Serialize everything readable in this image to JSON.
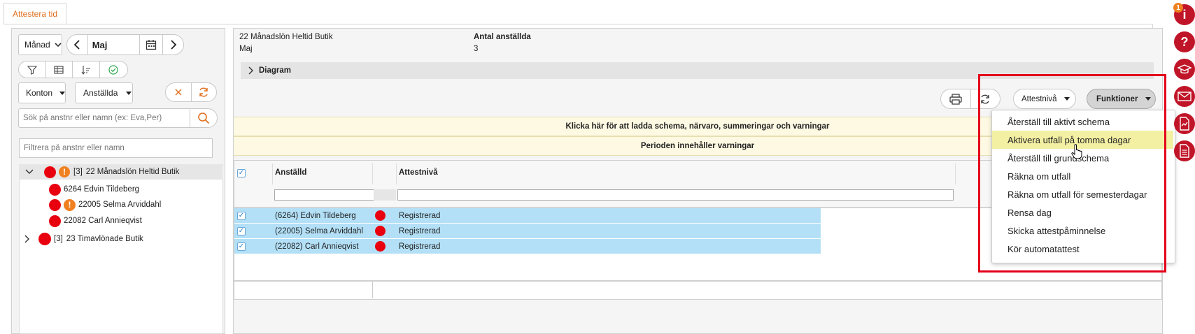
{
  "tab": {
    "label": "Attestera tid"
  },
  "toolbar": {
    "period_select": "Månad",
    "period_value": "Maj",
    "konton_select": "Konton",
    "anstallda_select": "Anställda",
    "search_placeholder": "Sök på anstnr eller namn (ex: Eva,Per)",
    "filter_placeholder": "Filtrera på anstnr eller namn"
  },
  "tree": {
    "group1": {
      "count": "[3]",
      "name": "22 Månadslön Heltid Butik"
    },
    "employees": [
      {
        "label": "6264 Edvin Tildeberg"
      },
      {
        "label": "22005 Selma Arviddahl"
      },
      {
        "label": "22082 Carl Annieqvist"
      }
    ],
    "group2": {
      "count": "[3]",
      "name": "23 Timavlönade Butik"
    }
  },
  "header": {
    "group_name": "22 Månadslön Heltid Butik",
    "period": "Maj",
    "count_label": "Antal anställda",
    "count_value": "3",
    "diagram_label": "Diagram"
  },
  "actions": {
    "attestniva_label": "Attestnivå",
    "funktioner_label": "Funktioner"
  },
  "banners": {
    "load_text": "Klicka här för att ladda schema, närvaro, summeringar och varningar",
    "warning_text": "Perioden innehåller varningar"
  },
  "grid": {
    "col_employee": "Anställd",
    "col_level": "Attestnivå",
    "rows": [
      {
        "employee": "(6264) Edvin Tildeberg",
        "level": "Registrerad"
      },
      {
        "employee": "(22005) Selma Arviddahl",
        "level": "Registrerad"
      },
      {
        "employee": "(22082) Carl Annieqvist",
        "level": "Registrerad"
      }
    ]
  },
  "menu": {
    "items": [
      {
        "label": "Återställ till aktivt schema"
      },
      {
        "label": "Aktivera utfall på tomma dagar"
      },
      {
        "label": "Återställ till grundschema"
      },
      {
        "label": "Räkna om utfall"
      },
      {
        "label": "Räkna om utfall för semesterdagar"
      },
      {
        "label": "Rensa dag"
      },
      {
        "label": "Skicka attestpåminnelse"
      },
      {
        "label": "Kör automatattest"
      }
    ]
  },
  "side": {
    "info_badge": "1"
  },
  "colors": {
    "accent": "#e07020",
    "status_red": "#e8000f",
    "selected_row": "#b3e0f7",
    "highlight": "#f5f0a0",
    "side_icon": "#c01528",
    "callout": "#e4001b"
  }
}
